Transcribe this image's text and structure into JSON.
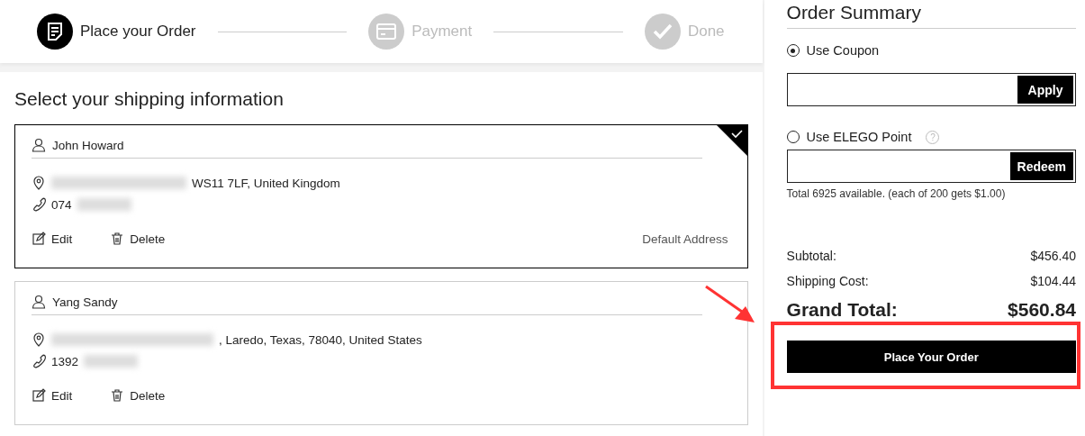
{
  "steps": [
    {
      "label": "Place your Order",
      "kind": "order",
      "active": true
    },
    {
      "label": "Payment",
      "kind": "payment",
      "active": false
    },
    {
      "label": "Done",
      "kind": "done",
      "active": false
    }
  ],
  "shipping": {
    "title": "Select your shipping information",
    "addresses": [
      {
        "name": "John Howard",
        "address": "WS11 7LF, United Kingdom",
        "phone": "074",
        "actions": [
          {
            "label": "Edit",
            "kind": "edit"
          },
          {
            "label": "Delete",
            "kind": "delete"
          }
        ],
        "badge": "Default Address",
        "selected": true
      },
      {
        "name": "Yang Sandy",
        "address": ", Laredo, Texas, 78040, United States",
        "phone": "1392",
        "actions": [
          {
            "label": "Edit",
            "kind": "edit"
          },
          {
            "label": "Delete",
            "kind": "delete"
          }
        ],
        "selected": false
      }
    ]
  },
  "summary": {
    "title": "Order Summary",
    "options": [
      {
        "label": "Use Coupon",
        "selected": true,
        "button": "Apply"
      },
      {
        "label": "Use ELEGO Point",
        "selected": false,
        "button": "Redeem",
        "help": "?",
        "note": "Total 6925 available. (each of 200 gets $1.00)"
      }
    ],
    "totals": [
      {
        "label": "Subtotal:",
        "value": "$456.40",
        "kind": "line"
      },
      {
        "label": "Shipping Cost:",
        "value": "$104.44",
        "kind": "line"
      },
      {
        "label": "Grand Total:",
        "value": "$560.84",
        "kind": "grand"
      }
    ],
    "order_button": "Place Your Order"
  }
}
